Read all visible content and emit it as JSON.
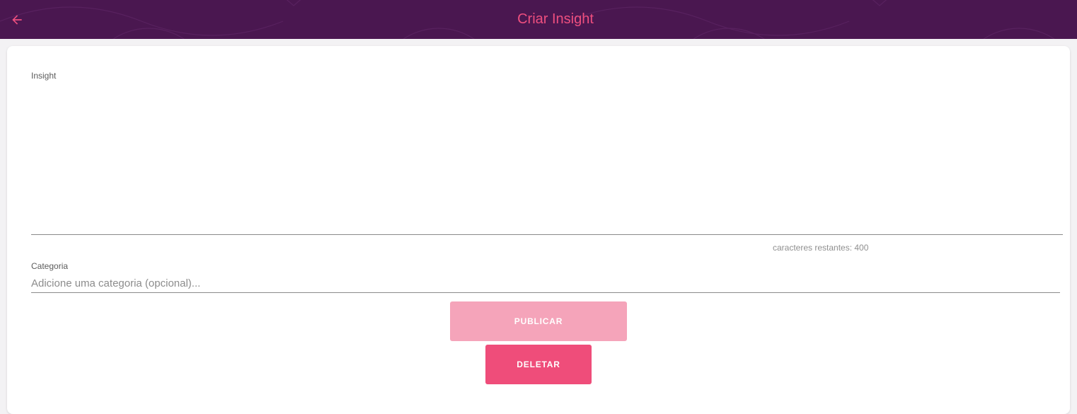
{
  "header": {
    "title": "Criar Insight",
    "back_icon": "arrow-left-icon",
    "background_color": "#4a1750",
    "title_color": "#ee4f7f"
  },
  "form": {
    "insight": {
      "label": "Insight",
      "value": "",
      "counter_text": "caracteres restantes: 400"
    },
    "categoria": {
      "label": "Categoria",
      "value": "",
      "placeholder": "Adicione uma categoria (opcional)..."
    },
    "buttons": {
      "publish_label": "PUBLICAR",
      "publish_color": "#f5a4ba",
      "delete_label": "DELETAR",
      "delete_color": "#ef4d7a"
    }
  }
}
